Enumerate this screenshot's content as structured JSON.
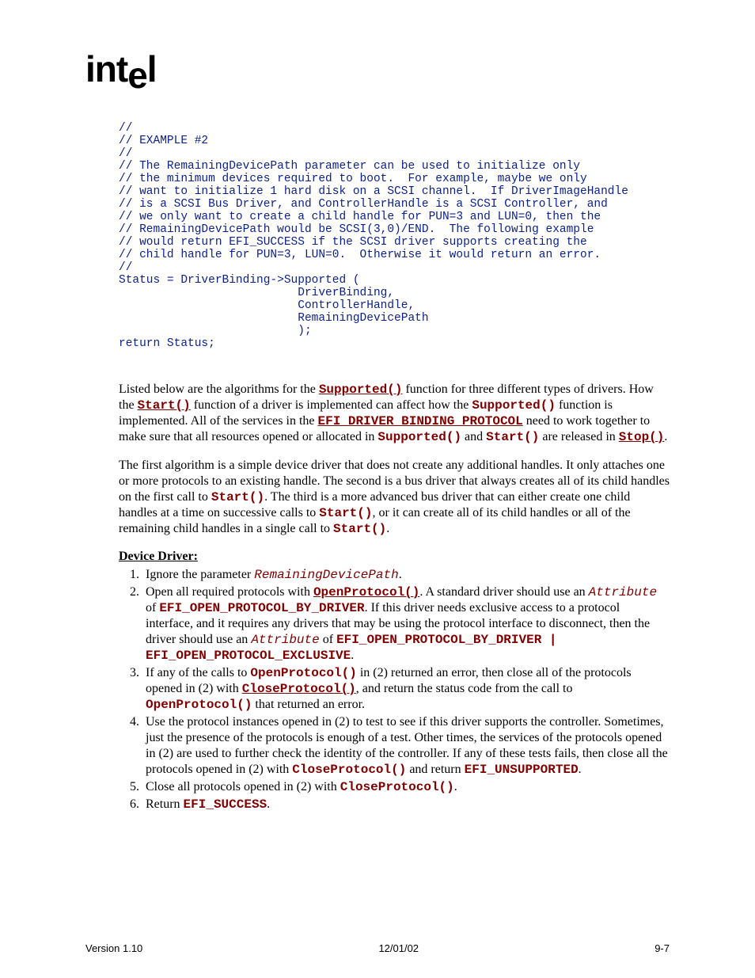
{
  "logo": "intel",
  "code": "//\n// EXAMPLE #2\n//\n// The RemainingDevicePath parameter can be used to initialize only\n// the minimum devices required to boot.  For example, maybe we only\n// want to initialize 1 hard disk on a SCSI channel.  If DriverImageHandle\n// is a SCSI Bus Driver, and ControllerHandle is a SCSI Controller, and\n// we only want to create a child handle for PUN=3 and LUN=0, then the\n// RemainingDevicePath would be SCSI(3,0)/END.  The following example\n// would return EFI_SUCCESS if the SCSI driver supports creating the\n// child handle for PUN=3, LUN=0.  Otherwise it would return an error.\n//\nStatus = DriverBinding->Supported (\n                          DriverBinding,\n                          ControllerHandle,\n                          RemainingDevicePath\n                          );\nreturn Status;",
  "para1": {
    "t1": "Listed below are the algorithms for the ",
    "l1": "Supported()",
    "t2": " function for three different types of drivers.  How the ",
    "l2": "Start()",
    "t3": " function of a driver is implemented can affect how the ",
    "b1": "Supported()",
    "t4": " function is implemented.  All of the services in the ",
    "l3": "EFI_DRIVER_BINDING_PROTOCOL",
    "t5": " need to work together to make sure that all resources opened or allocated in ",
    "b2": "Supported()",
    "t6": " and ",
    "b3": "Start()",
    "t7": " are released in ",
    "l4": "Stop()",
    "t8": "."
  },
  "para2": {
    "t1": "The first algorithm is a simple device driver that does not create any additional handles.  It only attaches one or more protocols to an existing handle.  The second is a bus driver that always creates all of its child handles on the first call to ",
    "b1": "Start()",
    "t2": ".  The third is a more advanced bus driver that can either create one child handles at a time on successive calls to ",
    "b2": "Start()",
    "t3": ", or it can create all of its child handles or all of the remaining child handles in a single call to ",
    "b3": "Start()",
    "t4": "."
  },
  "section_title": "Device Driver:",
  "list": {
    "i1": {
      "t1": "Ignore the parameter ",
      "i1": "RemainingDevicePath",
      "t2": "."
    },
    "i2": {
      "t1": "Open all required protocols with ",
      "l1": "OpenProtocol()",
      "t2": ".  A standard driver should use an ",
      "i1": "Attribute",
      "t3": " of ",
      "b1": "EFI_OPEN_PROTOCOL_BY_DRIVER",
      "t4": ".  If this driver needs exclusive access to a protocol interface, and it requires any drivers that may be using the protocol interface to disconnect, then the driver should use an ",
      "i2": "Attribute",
      "t5": " of ",
      "b2": "EFI_OPEN_PROTOCOL_BY_DRIVER | EFI_OPEN_PROTOCOL_EXCLUSIVE",
      "t6": "."
    },
    "i3": {
      "t1": "If any of the calls to ",
      "b1": "OpenProtocol()",
      "t2": " in (2) returned an error, then close all of the protocols opened in (2) with ",
      "l1": "CloseProtocol()",
      "t3": ", and return the status code from the call to ",
      "b2": "OpenProtocol()",
      "t4": " that returned an error."
    },
    "i4": {
      "t1": "Use the protocol instances opened in (2) to test to see if this driver supports the controller.  Sometimes, just the presence of the protocols is enough of a test.  Other times, the services of the protocols opened in (2) are used to further check the identity of the controller.  If any of these tests fails, then close all the protocols opened in (2) with ",
      "b1": "CloseProtocol()",
      "t2": " and return ",
      "b2": "EFI_UNSUPPORTED",
      "t3": "."
    },
    "i5": {
      "t1": "Close all protocols opened in (2) with ",
      "b1": "CloseProtocol()",
      "t2": "."
    },
    "i6": {
      "t1": "Return ",
      "b1": "EFI_SUCCESS",
      "t2": "."
    }
  },
  "footer": {
    "left": "Version 1.10",
    "center": "12/01/02",
    "right": "9-7"
  }
}
